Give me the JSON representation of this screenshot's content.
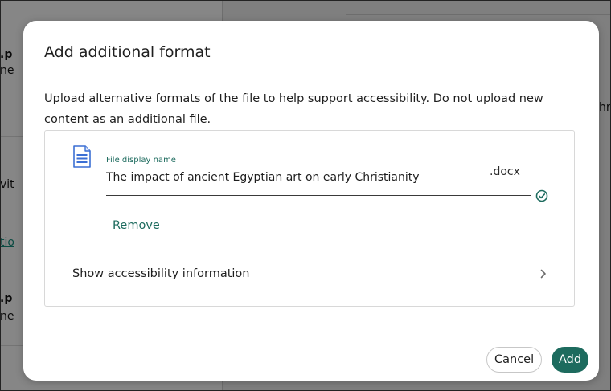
{
  "background": {
    "fragments": [
      {
        "text": ".p",
        "style": "bold"
      },
      {
        "text": "ne",
        "style": ""
      },
      {
        "text": "vit",
        "style": ""
      },
      {
        "text": "tio",
        "style": "link"
      },
      {
        "text": ".p",
        "style": "bold"
      },
      {
        "text": "ne",
        "style": ""
      },
      {
        "text": "hr",
        "style": ""
      }
    ]
  },
  "dialog": {
    "title": "Add additional format",
    "description": "Upload alternative formats of the file to help support accessibility. Do not upload new content as an additional file.",
    "file": {
      "icon": "document-icon",
      "label": "File display name",
      "value": "The impact of ancient Egyptian art on early Christianity",
      "extension": ".docx",
      "status_icon": "check-circle-icon",
      "remove_label": "Remove"
    },
    "accessibility": {
      "label": "Show accessibility information",
      "icon": "chevron-right-icon"
    },
    "buttons": {
      "cancel": "Cancel",
      "add": "Add"
    }
  },
  "colors": {
    "accent": "#1d6b5e",
    "overlay": "#7f7f7f",
    "text": "#1e1e1e",
    "doc_icon": "#3b6fd4"
  }
}
